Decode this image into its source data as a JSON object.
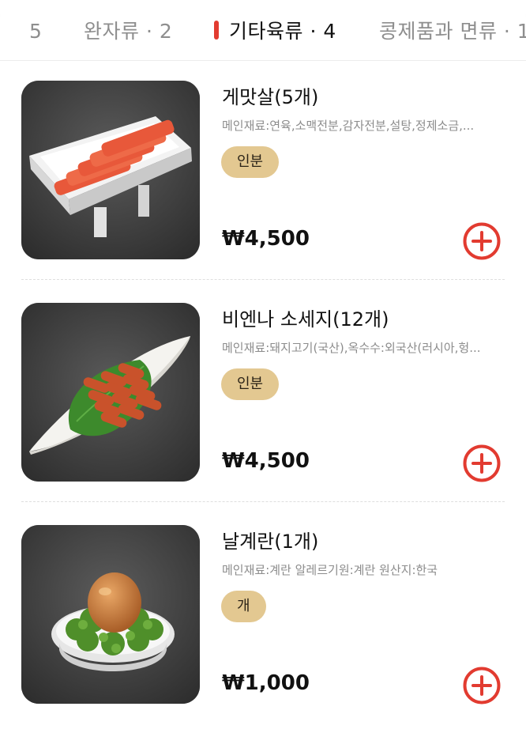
{
  "tabs": [
    {
      "label": "5"
    },
    {
      "label": "완자류 · 2"
    },
    {
      "label": "기타육류 · 4",
      "active": true
    },
    {
      "label": "콩제품과 면류 · 1"
    }
  ],
  "items": [
    {
      "name": "게맛살(5개)",
      "description": "메인재료:연육,소맥전분,감자전분,설탕,정제소금,...",
      "unit": "인분",
      "price": "₩4,500"
    },
    {
      "name": "비엔나 소세지(12개)",
      "description": "메인재료:돼지고기(국산),옥수수:외국산(러시아,헝...",
      "unit": "인분",
      "price": "₩4,500"
    },
    {
      "name": "날계란(1개)",
      "description": "메인재료:계란 알레르기원:계란 원산지:한국",
      "unit": "개",
      "price": "₩1,000"
    }
  ],
  "icons": {
    "add": "plus-circle-icon"
  },
  "colors": {
    "accent": "#e23b30",
    "badge": "#e3c891",
    "muted_text": "#8c8c8c"
  }
}
